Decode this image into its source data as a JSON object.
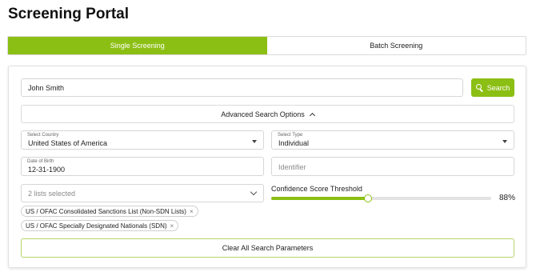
{
  "page": {
    "title": "Screening Portal"
  },
  "tabs": [
    {
      "label": "Single Screening",
      "active": true
    },
    {
      "label": "Batch Screening",
      "active": false
    }
  ],
  "search": {
    "name_value": "John Smith",
    "button_label": "Search"
  },
  "advanced": {
    "label": "Advanced Search Options",
    "expanded": true
  },
  "country": {
    "label": "Select Country",
    "value": "United States of America"
  },
  "type": {
    "label": "Select Type",
    "value": "Individual"
  },
  "dob": {
    "label": "Date of Birth",
    "value": "12-31-1900"
  },
  "identifier": {
    "placeholder": "Identifier",
    "value": ""
  },
  "lists": {
    "summary": "2 lists selected",
    "selected": [
      "US / OFAC Consolidated Sanctions List (Non-SDN Lists)",
      "US / OFAC Specially Designated Nationals (SDN)"
    ],
    "remove_glyph": "×"
  },
  "confidence": {
    "label": "Confidence Score Threshold",
    "value": 88,
    "display": "88%"
  },
  "clear": {
    "label": "Clear All Search Parameters"
  },
  "colors": {
    "accent": "#8cbf14"
  }
}
